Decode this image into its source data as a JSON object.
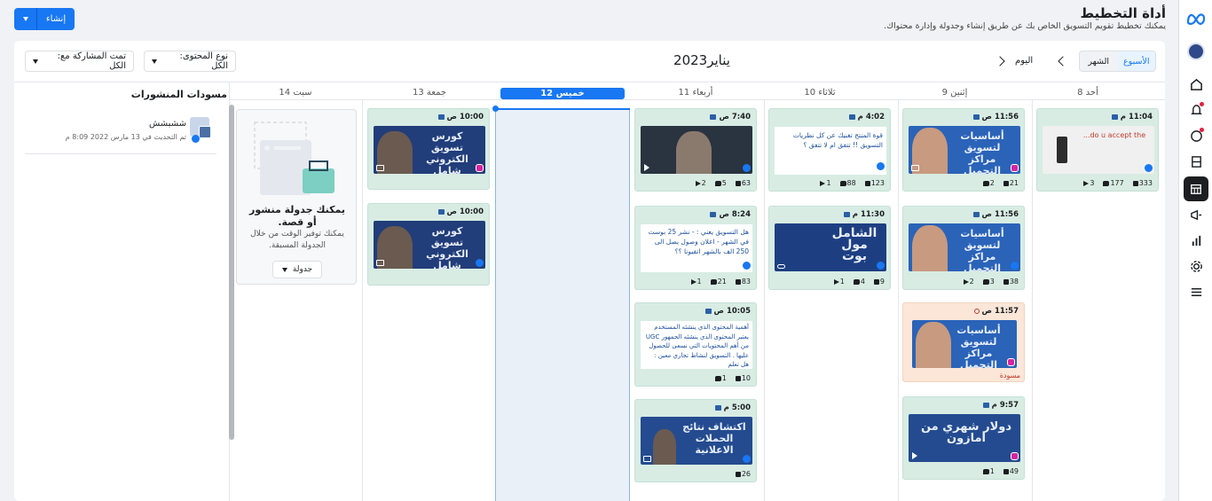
{
  "header": {
    "title": "أداة التخطيط",
    "subtitle": "يمكنك تخطيط تقويم التسويق الخاص بك عن طريق إنشاء وجدولة وإدارة محتواك.",
    "create_label": "إنشاء"
  },
  "toolbar": {
    "view_week": "الأسبوع",
    "view_month": "الشهر",
    "today_label": "اليوم",
    "month_title": "يناير2023",
    "content_type_filter": "نوع المحتوى: الكل",
    "shared_with_filter": "تمت المشاركة مع: الكل"
  },
  "drafts": {
    "title": "مسودات المنشورات",
    "item_name": "ششبشش",
    "item_updated": "تم التحديث في 13 مارس 2022 8:09 م"
  },
  "days": [
    {
      "label": "أحد 8"
    },
    {
      "label": "إثنين 9"
    },
    {
      "label": "ثلاثاء 10"
    },
    {
      "label": "أربعاء 11"
    },
    {
      "label": "خميس 12"
    },
    {
      "label": "جمعة 13"
    },
    {
      "label": "سبت 14"
    }
  ],
  "placeholder": {
    "title": "يمكنك جدولة منشور أو قصة.",
    "text": "يمكنك توفير الوقت من خلال الجدولة المسبقة.",
    "button": "جدولة"
  },
  "posts": {
    "sun1": {
      "time": "11:04 م",
      "likes": "333",
      "comments": "177",
      "shares": "3",
      "thumb_text": "do u accept the..."
    },
    "mon1": {
      "time": "11:56 ص",
      "likes": "21",
      "comments": "2",
      "thumb_text": "أساسيات لتسويق مراكز التجميل"
    },
    "mon2": {
      "time": "11:56 ص",
      "likes": "38",
      "comments": "3",
      "shares": "2",
      "thumb_text": "أساسيات لتسويق مراكز التجميل"
    },
    "mon3": {
      "time": "11:57 ص",
      "draft_label": "مسودة",
      "thumb_text": "أساسيات لتسويق مراكز التجميل"
    },
    "mon4": {
      "time": "9:57 م",
      "likes": "49",
      "comments": "1",
      "thumb_text": "دولار شهري من امازون"
    },
    "tue1": {
      "time": "4:02 م",
      "text": "قوة المنتج تغنيك عن كل نظريات التسويق !! تتفق ام لا تتفق ؟",
      "likes": "123",
      "comments": "88",
      "shares": "1"
    },
    "tue2": {
      "time": "11:30 م",
      "likes": "9",
      "comments": "4",
      "shares": "1",
      "thumb_text": "الشامل مول بوت"
    },
    "wed1": {
      "time": "7:40 ص",
      "likes": "63",
      "comments": "5",
      "shares": "2"
    },
    "wed2": {
      "time": "8:24 ص",
      "text": "هل التسويق يعني : - نشر 25 بوست في الشهر - اعلان وصول يصل الى 250 الف بالشهر اتفيونا ؟؟",
      "likes": "83",
      "comments": "21",
      "shares": "1"
    },
    "wed3": {
      "time": "10:05 ص",
      "text": "أهمية المحتوى الذي ينشئه المستخدم يعتبر المحتوى الذي ينشئه الجمهور UGC من أهم المحتويات التي نسعى للحصول عليها . التسويق لنشاط تجاري معين : هل تعلم",
      "likes": "10",
      "comments": "1"
    },
    "wed4": {
      "time": "5:00 م",
      "likes": "26",
      "thumb_text": "اكتشاف نتائج الحملات الاعلانية"
    },
    "fri1": {
      "time": "10:00 ص",
      "thumb_text": "كورس تسويق الكتروني شامل"
    },
    "fri2": {
      "time": "10:00 ص",
      "thumb_text": "كورس تسويق الكتروني شامل"
    }
  }
}
